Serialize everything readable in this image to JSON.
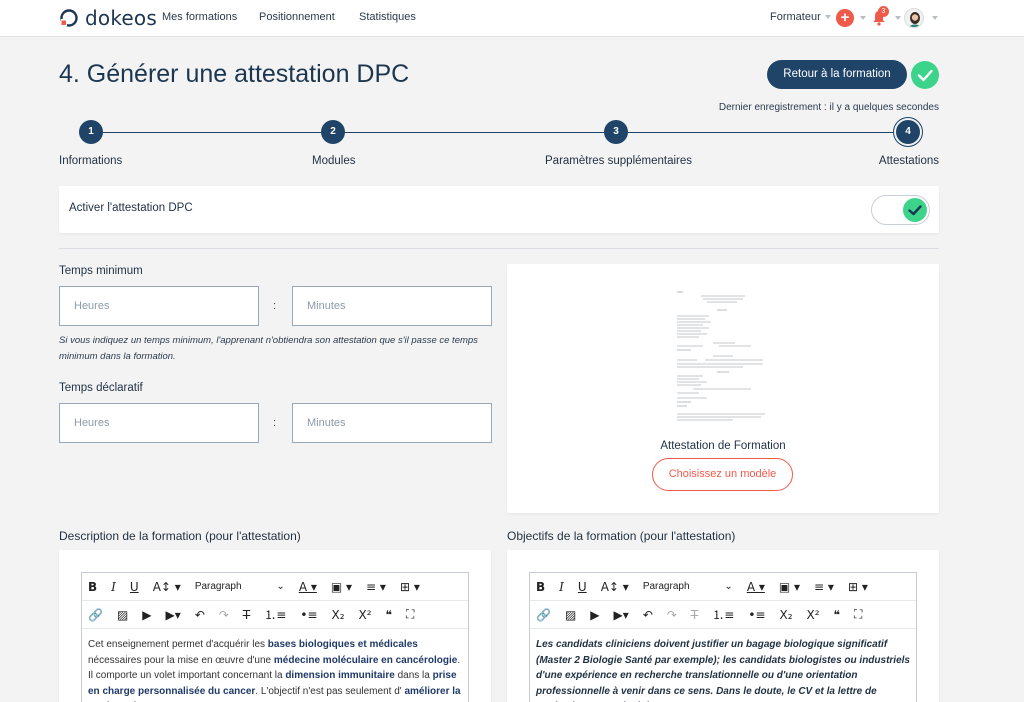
{
  "nav": {
    "brand": "dokeos",
    "links": [
      "Mes formations",
      "Positionnement",
      "Statistiques"
    ],
    "role": "Formateur",
    "notifications": "3"
  },
  "header": {
    "title": "4. Générer une attestation DPC",
    "back_label": "Retour à la formation",
    "last_save": "Dernier enregistrement : il y a quelques secondes"
  },
  "stepper": {
    "steps": [
      {
        "num": "1",
        "label": "Informations"
      },
      {
        "num": "2",
        "label": "Modules"
      },
      {
        "num": "3",
        "label": "Paramètres supplémentaires"
      },
      {
        "num": "4",
        "label": "Attestations"
      }
    ]
  },
  "toggle": {
    "label": "Activer l'attestation DPC",
    "on": true
  },
  "time_min": {
    "title": "Temps minimum",
    "hours_placeholder": "Heures",
    "minutes_placeholder": "Minutes",
    "hint": "Si vous indiquez un temps minimum, l'apprenant n'obtiendra son attestation que s'il passe ce temps minimum dans la formation."
  },
  "time_decl": {
    "title": "Temps déclaratif",
    "hours_placeholder": "Heures",
    "minutes_placeholder": "Minutes"
  },
  "separator": ":",
  "preview": {
    "title": "Attestation de Formation",
    "choose_label": "Choisissez un modèle"
  },
  "editors": {
    "paragraph": "Paragraph",
    "description": {
      "title": "Description de la formation (pour l'attestation)",
      "segments": [
        {
          "t": "Cet enseignement permet d'acquérir les ",
          "b": false
        },
        {
          "t": "bases biologiques et médicales",
          "b": true
        },
        {
          "t": " nécessaires pour la mise en œuvre d'une ",
          "b": false
        },
        {
          "t": "médecine moléculaire en cancérologie",
          "b": true
        },
        {
          "t": ". Il comporte un volet important concernant la ",
          "b": false
        },
        {
          "t": "dimension immunitaire",
          "b": true
        },
        {
          "t": " dans la ",
          "b": false
        },
        {
          "t": "prise en charge personnalisée du cancer",
          "b": true
        },
        {
          "t": ". L'objectif n'est pas seulement d' ",
          "b": false
        },
        {
          "t": "améliorer la pratique de",
          "b": true
        }
      ]
    },
    "objectives": {
      "title": "Objectifs de la formation (pour l'attestation)",
      "text": "Les candidats cliniciens doivent justifier un bagage biologique significatif (Master 2 Biologie Santé par exemple); les candidats biologistes ou industriels d'une expérience en recherche translationnelle ou d'une orientation professionnelle à venir dans ce sens. Dans le doute, le CV et la lettre de motivation transmis doivent"
    }
  }
}
